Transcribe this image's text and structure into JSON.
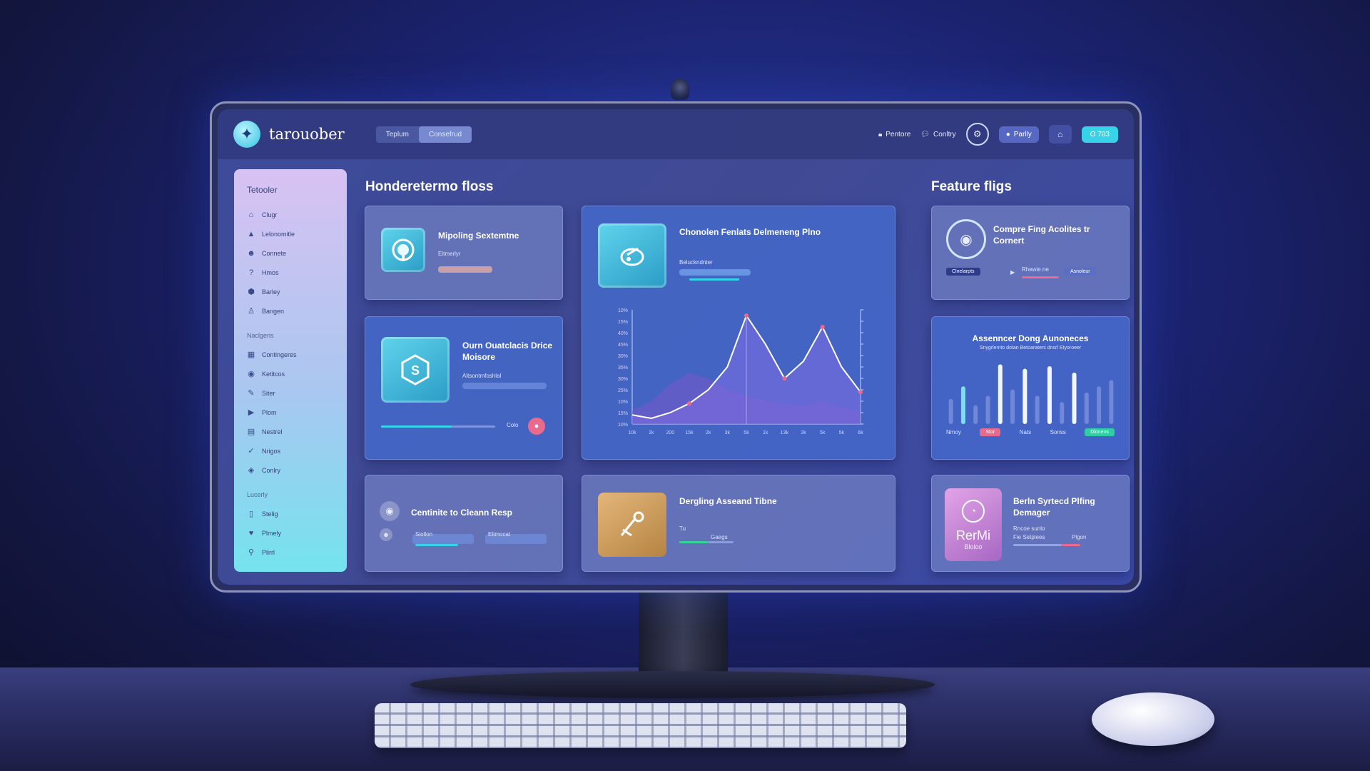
{
  "app": {
    "title": "tarouober"
  },
  "header": {
    "tabs": [
      {
        "label": "Teplum"
      },
      {
        "label": "Consefrud"
      }
    ],
    "links": [
      {
        "label": "Pentore",
        "icon": "lock-icon"
      },
      {
        "label": "Conltry",
        "icon": "chat-icon"
      }
    ],
    "profile_button": "Parlly",
    "accent_button": "O 703"
  },
  "sidebar": {
    "title": "Tetooler",
    "group1": [
      {
        "label": "Clugr",
        "icon": "home-icon"
      },
      {
        "label": "Lelonomitle",
        "icon": "bell-icon"
      },
      {
        "label": "Connete",
        "icon": "user-icon"
      },
      {
        "label": "Hmos",
        "icon": "pin-icon"
      },
      {
        "label": "Barley",
        "icon": "shield-icon"
      },
      {
        "label": "Bangen",
        "icon": "person-icon"
      }
    ],
    "section2": "Naclgeris",
    "group2": [
      {
        "label": "Contingeres",
        "icon": "grid-icon"
      },
      {
        "label": "Ketitcos",
        "icon": "globe-icon"
      },
      {
        "label": "Siter",
        "icon": "edit-icon"
      },
      {
        "label": "Plom",
        "icon": "play-icon"
      },
      {
        "label": "Nestrel",
        "icon": "calendar-icon"
      },
      {
        "label": "Nrigos",
        "icon": "check-icon"
      },
      {
        "label": "Conlry",
        "icon": "tag-icon"
      }
    ],
    "section3": "Lucerly",
    "group3": [
      {
        "label": "Stelig",
        "icon": "file-icon"
      },
      {
        "label": "Plmely",
        "icon": "heart-icon"
      },
      {
        "label": "Plirrl",
        "icon": "link-icon"
      }
    ]
  },
  "main": {
    "heading": "Honderetermo floss",
    "card1": {
      "title": "Mipoling Sextemtne",
      "sub": "Eitmerlyr"
    },
    "card2": {
      "title": "Chonolen Fenlats Delmeneng Plno",
      "sub": "Beluckndnter"
    },
    "card3": {
      "title": "Ourn Ouatclacis Drice Moisore",
      "sub": "Altsontmfoshlal",
      "slider_label": "Colo",
      "slider_value": 0.62
    },
    "card4": {
      "title": "Centinite to Cleann Resp",
      "sub1": "Siollon",
      "sub2": "Eltmocat"
    },
    "card5": {
      "title": "Dergling Asseand Tibne",
      "sub": "Tu",
      "sub2": "Gaegs"
    }
  },
  "feature": {
    "heading": "Feature fligs",
    "card1": {
      "title": "Compre Fing Acolites tr Cornert",
      "btn1": "Clnelarpts",
      "btn2": "Rhewie ne",
      "btn3": "Asnoleur"
    },
    "card2": {
      "title": "Assenncer Dong Aunoneces",
      "sub": "Snygrlemto dotan Betoaraters dnsrl Etyoroeer",
      "legend": [
        "Nmoy",
        "Stor",
        "Nats",
        "Sonss",
        "Dlonens"
      ]
    },
    "card3": {
      "title": "Berln Syrtecd Plfing Demager",
      "logo_text": "RerMi",
      "logo_sub": "Bloloo",
      "sub": "Rncoe sunlo",
      "sub2": "Fie Setplees",
      "sub3": "Plgon"
    }
  },
  "chart_data": [
    {
      "type": "area",
      "x": [
        "10k",
        "1k",
        "200",
        "15k",
        "2k",
        "3k",
        "5k",
        "1k",
        "13k",
        "3k",
        "5k",
        "5k",
        "6k"
      ],
      "series": [
        {
          "values": [
            8,
            5,
            10,
            18,
            30,
            50,
            95,
            70,
            40,
            55,
            85,
            50,
            28
          ]
        },
        {
          "values": [
            12,
            20,
            35,
            45,
            40,
            30,
            25,
            20,
            18,
            16,
            20,
            15,
            10
          ]
        }
      ],
      "ylim": [
        0,
        100
      ],
      "yticks_left": [
        "10%",
        "15%",
        "40%",
        "45%",
        "30%",
        "35%",
        "30%",
        "25%",
        "10%",
        "15%",
        "10%"
      ]
    },
    {
      "type": "bar",
      "values": [
        40,
        60,
        30,
        45,
        95,
        55,
        88,
        45,
        92,
        35,
        82,
        50,
        60,
        70
      ],
      "highlighted": [
        1,
        4,
        6,
        8,
        10
      ],
      "ylim": [
        0,
        100
      ]
    }
  ],
  "colors": {
    "accent": "#37d3e8",
    "pink": "#e96a8c",
    "line": "#ffffff"
  }
}
